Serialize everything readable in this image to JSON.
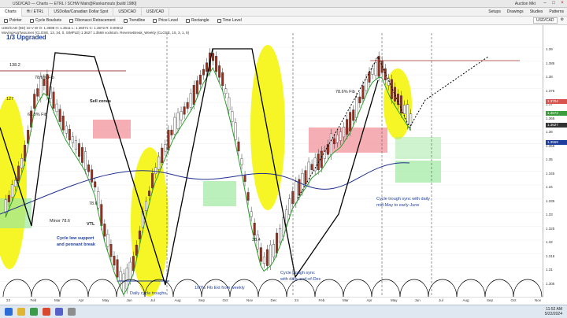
{
  "window": {
    "title_left": "USD/CAD — Charts — ETRL / SCHW  Main@Rankamouts  [build 1980]",
    "title_right": "Auction Mkt"
  },
  "tabs": [
    "Charts",
    "Hi / ETRL",
    "USDollar/Canadian Dollar Spot",
    "USD/CAD",
    "USD/CAD"
  ],
  "tabs_right": [
    "Setups",
    "Drawings",
    "Studies",
    "Patterns"
  ],
  "toolbar": {
    "tools": [
      "Pointer",
      "Cycle Brackets",
      "Fibonacci Retracement",
      "Trendline",
      "Price Level",
      "Rectangle",
      "Time Level"
    ],
    "symbol_value": "USD/CAD"
  },
  "legend": {
    "line1": "USD/CAD (8D) 10 V W  O: 1.3698  H: 1.3611  L: 1.36071  C: 1.3672  R: 0.00012",
    "line2": "MovingAvgTwoLines (CLOSE, 13, 34, 0, SIMPLE)  1.3627  1.3569   vocktom. ReverseBreak_Weekly (CLOSE, 15, 3, 1, 9)"
  },
  "heading": "1/3 Upgraded",
  "annotations": {
    "fib_138": "138.2",
    "fib_786_left": "78.6% Fib",
    "fib_127": "127",
    "fib_618": "61.8% Fib",
    "sell_zones": "Sell zones",
    "vtl": "VTL",
    "minor_786": "Minor 78.6",
    "fib_786_mid": "78.6",
    "cycle_low_support": "Cycle low support",
    "and_pennant": "and pennant break",
    "daily_cycle_troughs": "Daily cycle troughs",
    "fib_ext": "100% Fib Ext from weekly",
    "fib_384": "38.4",
    "fib_786_right": "78.6% Fib",
    "trough_sync_daily_1": "Cycle trough sync",
    "trough_sync_daily_2": "with daily end-of-Dec",
    "trough_sync_may_1": "Cycle trough sync with daily",
    "trough_sync_may_2": "mid-May to early-June"
  },
  "price_scale": [
    "1.39",
    "1.385",
    "1.38",
    "1.375",
    "1.37",
    "1.365",
    "1.36",
    "1.355",
    "1.35",
    "1.345",
    "1.34",
    "1.335",
    "1.33",
    "1.325",
    "1.32",
    "1.315",
    "1.31",
    "1.305"
  ],
  "price_tags": [
    {
      "label": "1.3704",
      "color": "#d9534f"
    },
    {
      "label": "1.3672",
      "color": "#3c9d3c"
    },
    {
      "label": "1.3627",
      "color": "#333333"
    },
    {
      "label": "1.3569",
      "color": "#1f3f9f"
    }
  ],
  "months": [
    "23",
    "Feb",
    "Mar",
    "Apr",
    "May",
    "Jun",
    "Jul",
    "Aug",
    "Sep",
    "Oct",
    "Nov",
    "Dec",
    "24",
    "Feb",
    "Mar",
    "Apr",
    "May",
    "Jun",
    "Jul",
    "Aug",
    "Sep",
    "Oct",
    "Nov"
  ],
  "colors": {
    "up": "#ffffff",
    "down": "#9b2f1a",
    "ma_fast": "#2e9e2e",
    "ma_slow": "#1f2f8f",
    "highlight": "#f5f500",
    "sell_zone": "#f28b96",
    "buy_zone": "#9ee89e",
    "accent": "#1f3f9f"
  },
  "taskbar": {
    "time": "11:52 AM",
    "date": "5/22/2024"
  }
}
